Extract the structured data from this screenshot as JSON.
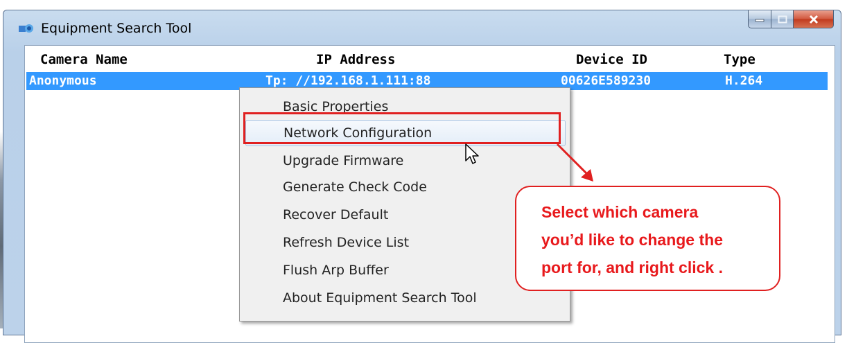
{
  "window": {
    "title": "Equipment Search Tool",
    "icon": "app-icon",
    "controls": [
      "minimize-icon",
      "maximize-icon",
      "close-icon"
    ]
  },
  "table": {
    "columns": [
      "Camera Name",
      "IP Address",
      "Device ID",
      "Type"
    ],
    "selected_row": {
      "camera_name": "Anonymous",
      "ip_address": "Tp: //192.168.1.111:88",
      "device_id": "00626E589230",
      "type": "H.264"
    }
  },
  "context_menu": {
    "items": [
      "Basic Properties",
      "Network Configuration",
      "Upgrade Firmware",
      "Generate Check Code",
      "Recover Default",
      "Refresh Device List",
      "Flush Arp Buffer",
      "About Equipment Search Tool"
    ],
    "hovered": "Network Configuration"
  },
  "annotation": {
    "line1": "Select which camera",
    "line2": "you’d like to change the",
    "line3": "port for, and right click .",
    "color": "#e8191c"
  }
}
